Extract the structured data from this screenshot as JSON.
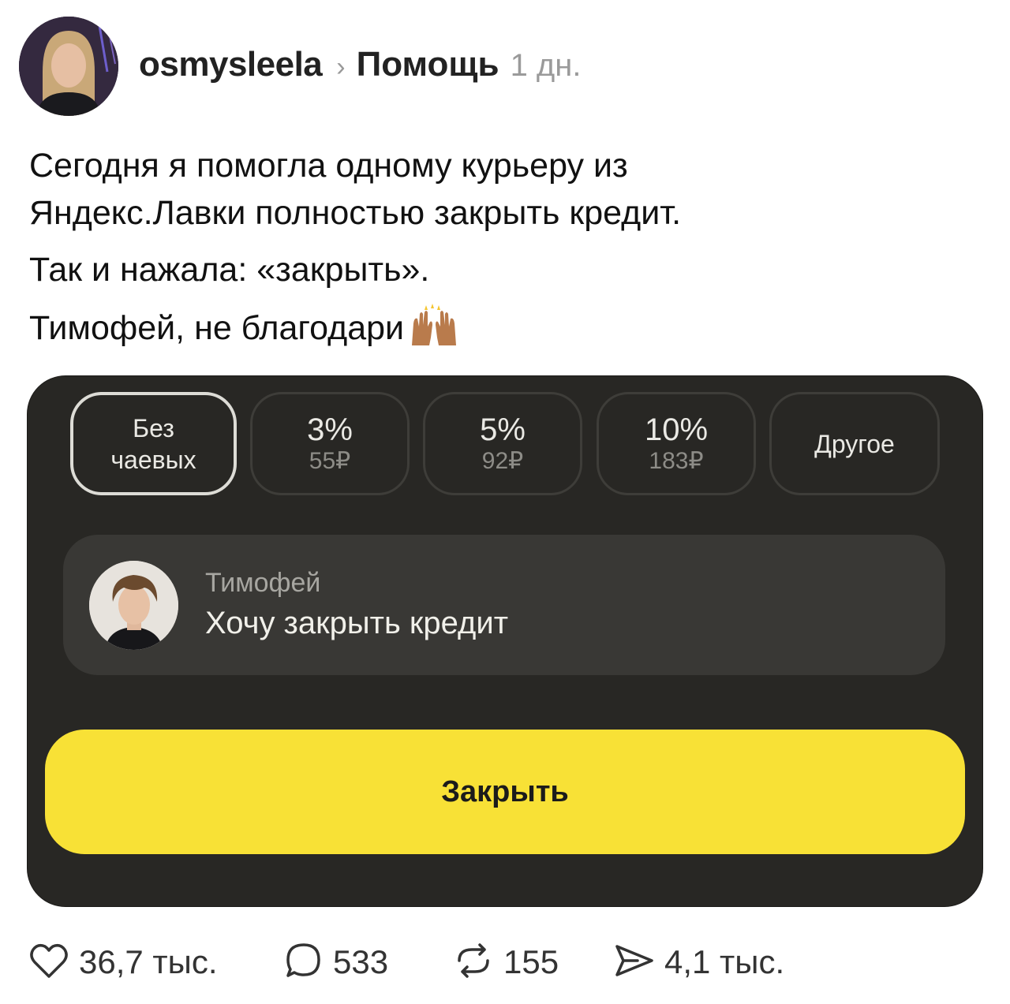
{
  "post": {
    "author": "osmysleela",
    "community": "Помощь",
    "time": "1 дн.",
    "text": [
      "Сегодня я помогла одному курьеру из",
      "Яндекс.Лавки полностью закрыть кредит.",
      "Так и нажала: «закрыть».",
      "Тимофей, не благодари"
    ],
    "emoji": "raising-hands-emoji"
  },
  "app": {
    "tips": [
      {
        "label": "Без чаевых",
        "selected": true
      },
      {
        "percent": "3%",
        "amount": "55₽"
      },
      {
        "percent": "5%",
        "amount": "92₽"
      },
      {
        "percent": "10%",
        "amount": "183₽"
      },
      {
        "label": "Другое"
      }
    ],
    "message": {
      "name": "Тимофей",
      "text": "Хочу закрыть кредит"
    },
    "button_label": "Закрыть",
    "colors": {
      "panel": "#282724",
      "card": "#393835",
      "button": "#f8e136"
    }
  },
  "actions": {
    "likes": "36,7 тыс.",
    "comments": "533",
    "reposts": "155",
    "shares": "4,1 тыс."
  }
}
